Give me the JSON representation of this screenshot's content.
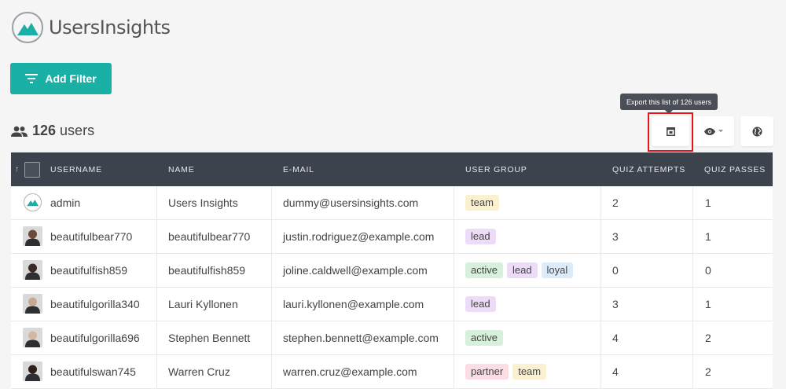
{
  "app": {
    "name": "UsersInsights"
  },
  "toolbar": {
    "add_filter_label": "Add Filter",
    "tooltip": "Export this list of 126 users"
  },
  "summary": {
    "count": "126",
    "unit": "users"
  },
  "table": {
    "headers": [
      "USERNAME",
      "NAME",
      "E-MAIL",
      "USER GROUP",
      "QUIZ ATTEMPTS",
      "QUIZ PASSES"
    ],
    "sort_indicator": "↑",
    "rows": [
      {
        "username": "admin",
        "name": "Users Insights",
        "email": "dummy@usersinsights.com",
        "groups": [
          "team"
        ],
        "attempts": "2",
        "passes": "1",
        "avatar": "logo"
      },
      {
        "username": "beautifulbear770",
        "name": "beautifulbear770",
        "email": "justin.rodriguez@example.com",
        "groups": [
          "lead"
        ],
        "attempts": "3",
        "passes": "1",
        "avatar": "photo"
      },
      {
        "username": "beautifulfish859",
        "name": "beautifulfish859",
        "email": "joline.caldwell@example.com",
        "groups": [
          "active",
          "lead",
          "loyal"
        ],
        "attempts": "0",
        "passes": "0",
        "avatar": "photo"
      },
      {
        "username": "beautifulgorilla340",
        "name": "Lauri Kyllonen",
        "email": "lauri.kyllonen@example.com",
        "groups": [
          "lead"
        ],
        "attempts": "3",
        "passes": "1",
        "avatar": "photo"
      },
      {
        "username": "beautifulgorilla696",
        "name": "Stephen Bennett",
        "email": "stephen.bennett@example.com",
        "groups": [
          "active"
        ],
        "attempts": "4",
        "passes": "2",
        "avatar": "photo"
      },
      {
        "username": "beautifulswan745",
        "name": "Warren Cruz",
        "email": "warren.cruz@example.com",
        "groups": [
          "partner",
          "team"
        ],
        "attempts": "4",
        "passes": "2",
        "avatar": "photo"
      }
    ]
  },
  "colors": {
    "accent": "#1bb0a5",
    "header_bg": "#3d434c",
    "highlight": "#e8131b",
    "tag_team": "#fbf0cf",
    "tag_lead": "#ecdcf7",
    "tag_active": "#d7f0dc",
    "tag_loyal": "#dcebfa",
    "tag_partner": "#fbdde6"
  },
  "avatar_tones": [
    "#6b4a3a",
    "#3a2a25",
    "#c9a893",
    "#d2b7a5",
    "#2c1e18"
  ]
}
